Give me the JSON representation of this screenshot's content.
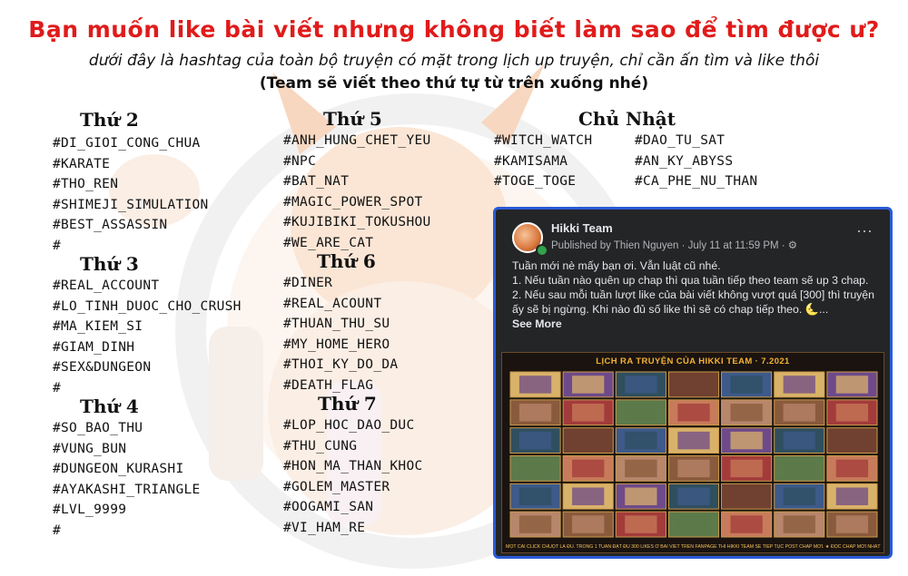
{
  "header": {
    "title": "Bạn muốn like bài viết nhưng không biết làm sao để tìm được ư?",
    "subtitle": "dưới đây là hashtag của toàn bộ truyện có mặt trong lịch up truyện, chỉ cần ấn tìm và like thôi",
    "note": "(Team sẽ viết theo thứ tự từ trên xuống nhé)"
  },
  "days": {
    "thu2": {
      "title": "Thứ 2",
      "tags": [
        "#DI_GIOI_CONG_CHUA",
        "#KARATE",
        "#THO_REN",
        "#SHIMEJI_SIMULATION",
        "#BEST_ASSASSIN",
        "#"
      ]
    },
    "thu3": {
      "title": "Thứ 3",
      "tags": [
        "#REAL_ACCOUNT",
        "#LO_TINH_DUOC_CHO_CRUSH",
        "#MA_KIEM_SI",
        "#GIAM_DINH",
        "#SEX&DUNGEON",
        "#"
      ]
    },
    "thu4": {
      "title": "Thứ 4",
      "tags": [
        "#SO_BAO_THU",
        "#VUNG_BUN",
        "#DUNGEON_KURASHI",
        "#AYAKASHI_TRIANGLE",
        "#LVL_9999",
        "#"
      ]
    },
    "thu5": {
      "title": "Thứ 5",
      "tags": [
        "#ANH_HUNG_CHET_YEU",
        "#NPC",
        "#BAT_NAT",
        "#MAGIC_POWER_SPOT",
        "#KUJIBIKI_TOKUSHOU",
        "#WE_ARE_CAT"
      ]
    },
    "thu6": {
      "title": "Thứ 6",
      "tags": [
        "#DINER",
        "#REAL_ACOUNT",
        "#THUAN_THU_SU",
        "#MY_HOME_HERO",
        "#THOI_KY_DO_DA",
        "#DEATH_FLAG"
      ]
    },
    "thu7": {
      "title": "Thứ 7",
      "tags": [
        "#LOP_HOC_DAO_DUC",
        "#THU_CUNG",
        "#HON_MA_THAN_KHOC",
        "#GOLEM_MASTER",
        "#OOGAMI_SAN",
        "#VI_HAM_RE"
      ]
    },
    "cn": {
      "title": "Chủ Nhật",
      "tags_col1": [
        "#WITCH_WATCH",
        "#KAMISAMA",
        "#TOGE_TOGE"
      ],
      "tags_col2": [
        "#DAO_TU_SAT",
        "#AN_KY_ABYSS",
        "#CA_PHE_NU_THAN"
      ]
    }
  },
  "fb_post": {
    "page_name": "Hikki Team",
    "meta": "Published by Thien Nguyen · July 11 at 11:59 PM · ⚙",
    "more_icon": "⋯",
    "lines": [
      "Tuần mới nè mấy bạn ơi. Vẫn luật cũ nhé.",
      "1. Nếu tuần nào quên up chap thì qua tuần tiếp theo team sẽ up 3 chap.",
      "2. Nếu sau mỗi tuần lượt like của bài viết không vượt quá [300] thì truyện ấy sẽ bị ngừng. Khi nào đủ số like thì sẽ có chap tiếp theo. 🌜..."
    ],
    "see_more": "See More",
    "schedule_title": "LỊCH RA TRUYỆN CỦA HIKKI TEAM · 7.2021",
    "schedule_footer": "MỘT CÁI CLICK CHUỘT LÀ ĐỦ. TRONG 1 TUẦN ĐẠT ĐỦ 300 LIKES Ở BÀI VIẾT TRÊN FANPAGE THÌ HIKKI TEAM SẼ TIẾP TỤC POST CHAP MỚI. ★ ĐỌC CHAP MỚI NHẤT TẠI: HTTPS://WWW.FACEBOOK.COM/GROUPS/HIKKITEAM",
    "schedule_grid": {
      "columns": 7,
      "rows": 6
    }
  },
  "colors": {
    "headline_red": "#e01b1b",
    "card_bg": "#242526",
    "card_border": "#2a5bd7",
    "schedule_gold": "#f2b233"
  }
}
